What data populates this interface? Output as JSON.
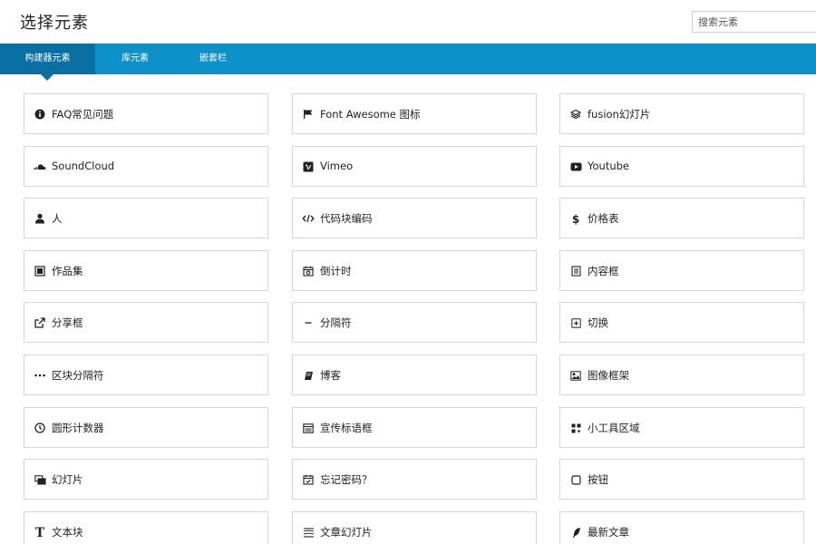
{
  "header": {
    "title": "选择元素",
    "search_placeholder": "搜索元素"
  },
  "tabs": [
    {
      "label": "构建器元素",
      "active": true
    },
    {
      "label": "库元素",
      "active": false
    },
    {
      "label": "嵌套栏",
      "active": false
    }
  ],
  "colors": {
    "tab_bar": "#0c91c9",
    "tab_active": "#0a6fa3"
  },
  "elements": [
    {
      "label": "FAQ常见问题",
      "icon": "info-circle-icon"
    },
    {
      "label": "Font Awesome 图标",
      "icon": "flag-icon"
    },
    {
      "label": "fusion幻灯片",
      "icon": "layers-icon"
    },
    {
      "label": "SoundCloud",
      "icon": "soundcloud-icon"
    },
    {
      "label": "Vimeo",
      "icon": "vimeo-icon"
    },
    {
      "label": "Youtube",
      "icon": "youtube-icon"
    },
    {
      "label": "人",
      "icon": "user-icon"
    },
    {
      "label": "代码块编码",
      "icon": "code-icon"
    },
    {
      "label": "价格表",
      "icon": "dollar-icon"
    },
    {
      "label": "作品集",
      "icon": "portfolio-icon"
    },
    {
      "label": "倒计时",
      "icon": "calendar-clock-icon"
    },
    {
      "label": "内容框",
      "icon": "content-box-icon"
    },
    {
      "label": "分享框",
      "icon": "share-icon"
    },
    {
      "label": "分隔符",
      "icon": "minus-icon"
    },
    {
      "label": "切换",
      "icon": "toggle-plus-icon"
    },
    {
      "label": "区块分隔符",
      "icon": "ellipsis-icon"
    },
    {
      "label": "博客",
      "icon": "book-icon"
    },
    {
      "label": "图像框架",
      "icon": "image-icon"
    },
    {
      "label": "圆形计数器",
      "icon": "clock-icon"
    },
    {
      "label": "宣传标语框",
      "icon": "tagline-box-icon"
    },
    {
      "label": "小工具区域",
      "icon": "widgets-icon"
    },
    {
      "label": "幻灯片",
      "icon": "slides-icon"
    },
    {
      "label": "忘记密码？",
      "icon": "calendar-check-icon"
    },
    {
      "label": "按钮",
      "icon": "button-square-icon"
    },
    {
      "label": "文本块",
      "icon": "text-t-icon"
    },
    {
      "label": "文章幻灯片",
      "icon": "stack-icon"
    },
    {
      "label": "最新文章",
      "icon": "feather-icon"
    }
  ]
}
